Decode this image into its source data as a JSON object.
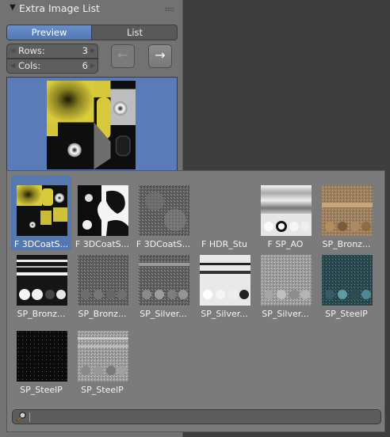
{
  "panel": {
    "title": "Extra Image List",
    "collapse_arrow": "▼",
    "tabs": [
      "Preview",
      "List"
    ],
    "active_tab": "Preview",
    "rows": {
      "label": "Rows:",
      "value": "3"
    },
    "cols": {
      "label": "Cols:",
      "value": "6"
    },
    "nav_back": "←",
    "nav_forward": "→"
  },
  "popup": {
    "items": [
      {
        "label": "F 3DCoatS...",
        "selected": true
      },
      {
        "label": "F 3DCoatS..."
      },
      {
        "label": "F 3DCoatS..."
      },
      {
        "label": "F HDR_Stu"
      },
      {
        "label": "F SP_AO"
      },
      {
        "label": "SP_Bronz..."
      },
      {
        "label": "SP_Bronz..."
      },
      {
        "label": "SP_Bronz..."
      },
      {
        "label": "SP_Silver..."
      },
      {
        "label": "SP_Silver..."
      },
      {
        "label": "SP_Silver..."
      },
      {
        "label": "SP_SteelP"
      },
      {
        "label": "SP_SteelP"
      },
      {
        "label": "SP_SteelP"
      }
    ],
    "search": {
      "value": "",
      "placeholder": ""
    }
  },
  "colors": {
    "selection": "#5578b0",
    "panel_bg": "#727272",
    "popup_bg": "#7b7b7b",
    "accent_yellow": "#d7c83a"
  },
  "icons": [
    "collapse-arrow-icon",
    "grip-icon",
    "arrow-left-icon",
    "arrow-right-icon",
    "search-icon"
  ]
}
